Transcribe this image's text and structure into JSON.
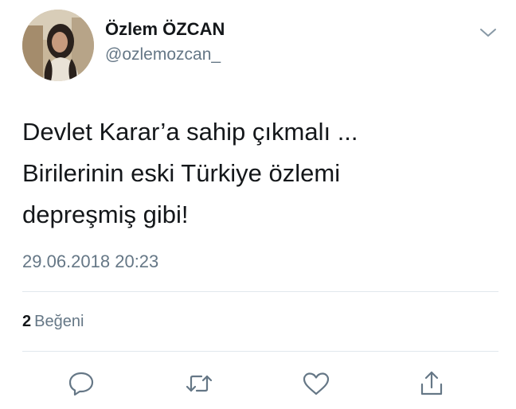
{
  "tweet": {
    "author": {
      "name": "Özlem ÖZCAN",
      "handle": "@ozlemozcan_"
    },
    "text_lines": [
      "Devlet Karar’a sahip çıkmalı ...",
      "Birilerinin eski Türkiye özlemi",
      "depreşmiş gibi!"
    ],
    "timestamp": "29.06.2018 20:23",
    "likes": {
      "count": "2",
      "label": "Beğeni"
    }
  },
  "icons": {
    "menu": "chevron-down-icon",
    "reply": "reply-icon",
    "retweet": "retweet-icon",
    "like": "heart-icon",
    "share": "share-icon"
  },
  "colors": {
    "text": "#14171a",
    "secondary": "#657786",
    "divider": "#e1e8ed",
    "icon": "#657786"
  }
}
